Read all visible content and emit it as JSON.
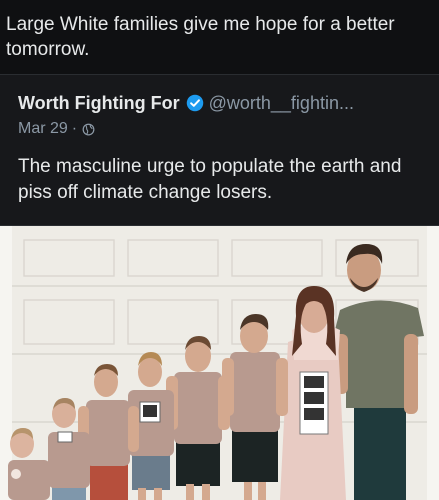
{
  "post": {
    "text": "Large White families give me hope for a better tomorrow."
  },
  "quote": {
    "name": "Worth Fighting For",
    "handle": "@worth__fightin...",
    "date": "Mar 29",
    "separator": "·",
    "text": "The masculine urge to populate the earth and piss off climate change losers."
  },
  "colors": {
    "background": "#0f1012",
    "card": "#17181b",
    "text": "#e7e9ea",
    "muted": "#8b98a5",
    "verified": "#1d9bf0"
  },
  "icons": {
    "verified": "verified-badge-icon",
    "audience": "globe-icon"
  }
}
